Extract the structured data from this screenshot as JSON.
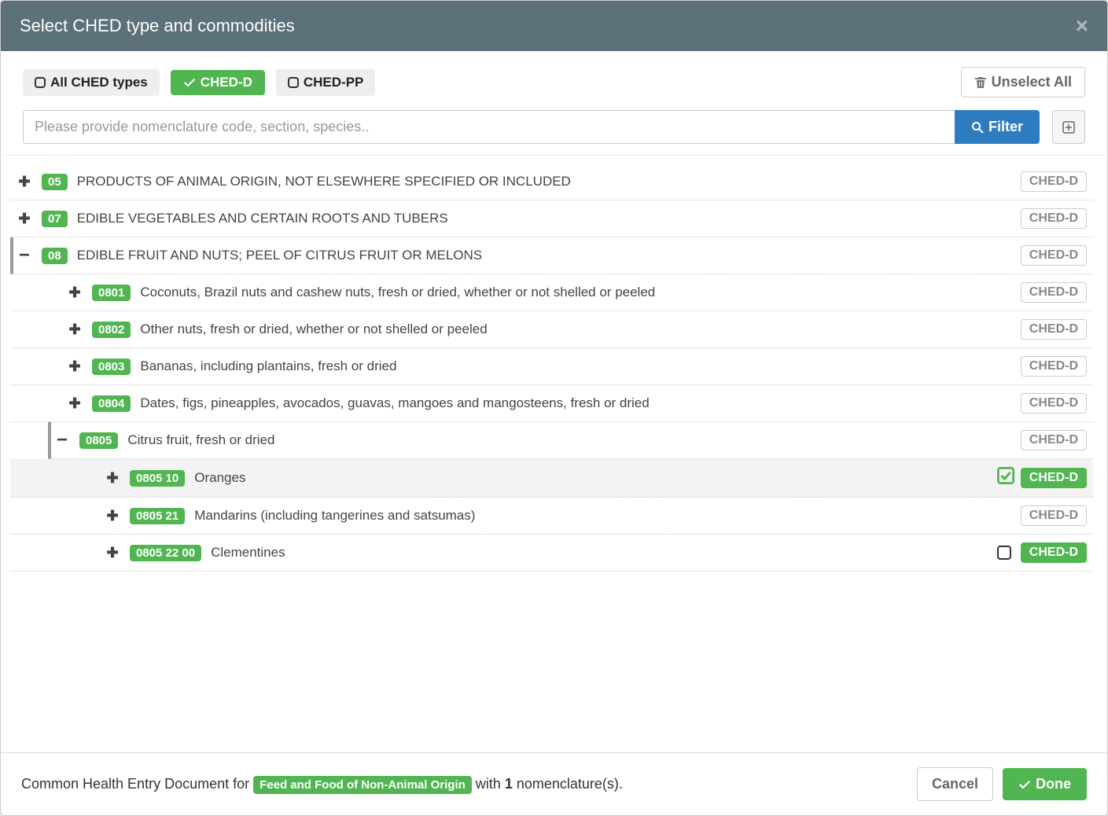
{
  "modal": {
    "title": "Select CHED type and commodities"
  },
  "toolbar": {
    "all_types_label": "All CHED types",
    "ched_d_label": "CHED-D",
    "ched_pp_label": "CHED-PP",
    "unselect_all_label": "Unselect All",
    "search_placeholder": "Please provide nomenclature code, section, species..",
    "filter_label": "Filter"
  },
  "badges": {
    "ched_d": "CHED-D"
  },
  "rows": {
    "r05": {
      "code": "05",
      "label": "PRODUCTS OF ANIMAL ORIGIN, NOT ELSEWHERE SPECIFIED OR INCLUDED"
    },
    "r07": {
      "code": "07",
      "label": "EDIBLE VEGETABLES AND CERTAIN ROOTS AND TUBERS"
    },
    "r08": {
      "code": "08",
      "label": "EDIBLE FRUIT AND NUTS; PEEL OF CITRUS FRUIT OR MELONS"
    },
    "r0801": {
      "code": "0801",
      "label": "Coconuts, Brazil nuts and cashew nuts, fresh or dried, whether or not shelled or peeled"
    },
    "r0802": {
      "code": "0802",
      "label": "Other nuts, fresh or dried, whether or not shelled or peeled"
    },
    "r0803": {
      "code": "0803",
      "label": "Bananas, including plantains, fresh or dried"
    },
    "r0804": {
      "code": "0804",
      "label": "Dates, figs, pineapples, avocados, guavas, mangoes and mangosteens, fresh or dried"
    },
    "r0805": {
      "code": "0805",
      "label": "Citrus fruit, fresh or dried"
    },
    "r080510": {
      "code": "0805 10",
      "label": "Oranges"
    },
    "r080521": {
      "code": "0805 21",
      "label": "Mandarins (including tangerines and satsumas)"
    },
    "r08052200": {
      "code": "0805 22 00",
      "label": "Clementines"
    }
  },
  "footer": {
    "prefix": "Common Health Entry Document for",
    "doc_type": "Feed and Food of Non-Animal Origin",
    "mid": "with",
    "count": "1",
    "suffix": "nomenclature(s).",
    "cancel": "Cancel",
    "done": "Done"
  }
}
